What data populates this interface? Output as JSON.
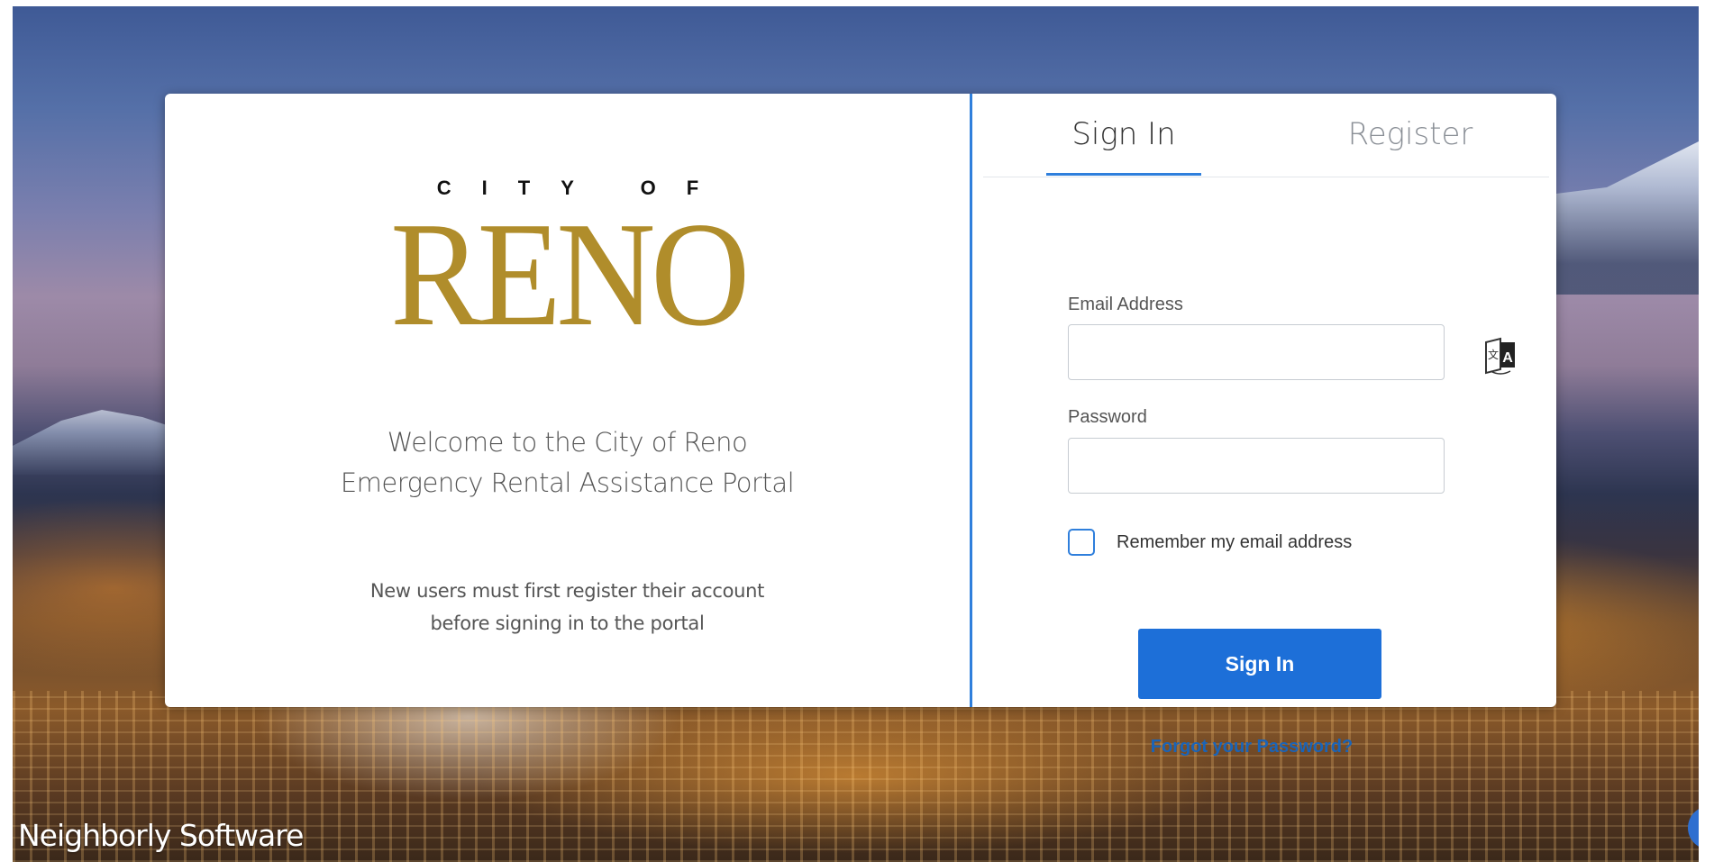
{
  "left_panel": {
    "logo": {
      "top_text": "CITY OF",
      "main_text": "RENO"
    },
    "welcome_line1": "Welcome to the City of Reno",
    "welcome_line2": "Emergency Rental Assistance Portal",
    "note_line1": "New users must first register their account",
    "note_line2": "before signing in to the portal"
  },
  "tabs": [
    {
      "label": "Sign In",
      "active": true
    },
    {
      "label": "Register",
      "active": false
    }
  ],
  "form": {
    "email_label": "Email Address",
    "email_value": "",
    "password_label": "Password",
    "password_value": "",
    "remember_label": "Remember my email address",
    "remember_checked": false,
    "submit_label": "Sign In",
    "forgot_label": "Forgot your Password?",
    "translate_icon": "translate-icon"
  },
  "footer": {
    "brand": "Neighborly Software"
  },
  "colors": {
    "accent": "#2f7fdc",
    "button": "#1d6fd8",
    "link": "#1a64b8",
    "logo_gold": "#b08d2b"
  }
}
